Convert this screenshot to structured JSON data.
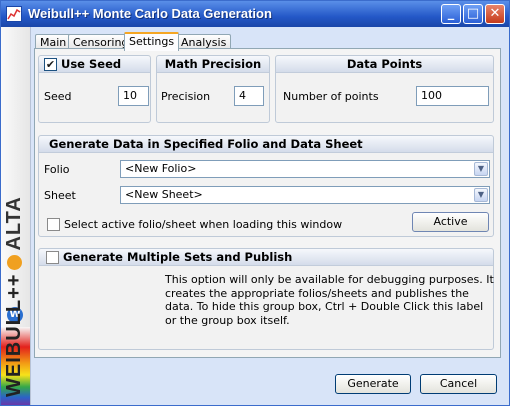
{
  "window": {
    "title": "Weibull++ Monte Carlo Data Generation",
    "minimize": "_",
    "maximize": "□",
    "close": "✕"
  },
  "sidebar": {
    "brand_left": "WEIBULL++",
    "brand_right": "ALTA",
    "logo_letter": "W"
  },
  "tabs": [
    {
      "label": "Main",
      "active": false
    },
    {
      "label": "Censoring",
      "active": false
    },
    {
      "label": "Settings",
      "active": true
    },
    {
      "label": "Analysis",
      "active": false
    }
  ],
  "use_seed": {
    "title": "Use Seed",
    "checked": true,
    "check_mark": "✔",
    "seed_label": "Seed",
    "seed_value": "10"
  },
  "math_precision": {
    "title": "Math Precision",
    "precision_label": "Precision",
    "precision_value": "4"
  },
  "data_points": {
    "title": "Data Points",
    "label": "Number of points",
    "value": "100"
  },
  "folio_group": {
    "title": "Generate Data in Specified Folio and Data Sheet",
    "folio_label": "Folio",
    "folio_value": "<New Folio>",
    "sheet_label": "Sheet",
    "sheet_value": "<New Sheet>",
    "active_checkbox_label": "Select active folio/sheet when loading this window",
    "active_button": "Active"
  },
  "multiple_sets": {
    "title": "Generate Multiple Sets and Publish",
    "note": "This option will only be available for debugging purposes. It creates the appropriate folios/sheets and publishes the data. To hide this group box, Ctrl + Double Click this label or the group box itself."
  },
  "footer": {
    "generate": "Generate",
    "cancel": "Cancel"
  }
}
